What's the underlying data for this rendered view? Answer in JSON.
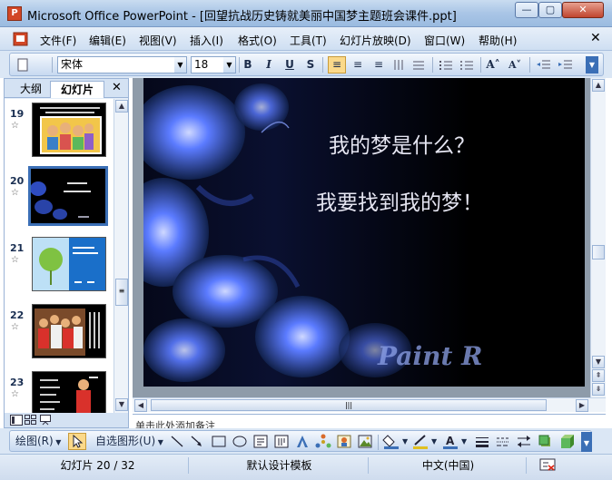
{
  "window": {
    "title": "Microsoft Office PowerPoint - [回望抗战历史铸就美丽中国梦主题班会课件.ppt]",
    "app_icon_letter": "P",
    "controls": {
      "minimize": "—",
      "maximize": "▢",
      "close": "✕"
    }
  },
  "menubar": {
    "items": [
      "文件(F)",
      "编辑(E)",
      "视图(V)",
      "插入(I)",
      "格式(O)",
      "工具(T)",
      "幻灯片放映(D)",
      "窗口(W)",
      "帮助(H)"
    ],
    "close": "✕"
  },
  "toolbar": {
    "font_name": "宋体",
    "font_size": "18",
    "bold": "B",
    "italic": "I",
    "underline": "U",
    "shadow": "S",
    "align_left": "≡",
    "align_center": "≡",
    "align_right": "≡",
    "bigger_font": "A˄",
    "smaller_font": "A˅"
  },
  "left_panel": {
    "tabs": [
      "大纲",
      "幻灯片"
    ],
    "active_tab": "幻灯片",
    "close": "✕",
    "slides": [
      {
        "number": "19"
      },
      {
        "number": "20",
        "selected": true
      },
      {
        "number": "21"
      },
      {
        "number": "22"
      },
      {
        "number": "23"
      }
    ],
    "star": "☆"
  },
  "slide": {
    "line1": "我的梦是什么？",
    "line2": "我要找到我的梦！",
    "watermark": "Paint R"
  },
  "notes": {
    "text": "单击此处添加备注"
  },
  "drawbar": {
    "draw_label": "绘图(R)",
    "autoshapes_label": "自选图形(U)"
  },
  "status": {
    "slide_info": "幻灯片 20 / 32",
    "design": "默认设计模板",
    "language": "中文(中国)"
  },
  "colors": {
    "accent": "#3b6fb6",
    "slide_bg": "#000000",
    "flower": "#3a5ff0"
  }
}
